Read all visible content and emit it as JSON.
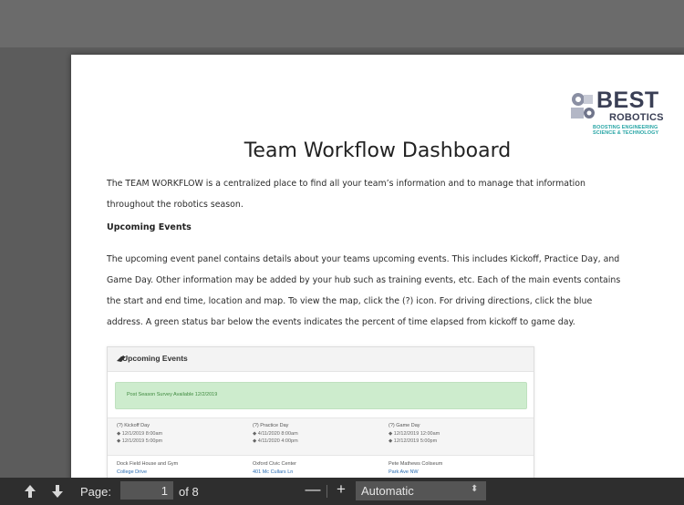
{
  "document": {
    "logo": {
      "name": "BEST",
      "sub": "ROBOTICS",
      "tagline_1": "BOOSTING ENGINEERING",
      "tagline_2": "SCIENCE & TECHNOLOGY"
    },
    "title": "Team Workflow Dashboard",
    "intro_line_1": "The TEAM WORKFLOW is a centralized place to find all your team’s information and to manage that information",
    "intro_line_2": "throughout the robotics season.",
    "section_heading": "Upcoming Events",
    "details_lines": [
      "The upcoming event panel contains details about your teams upcoming events. This includes Kickoff, Practice Day, and",
      "Game Day. Other information may be added by your hub such as training events, etc. Each of the main events contains",
      "the start and end time, location and map. To view the map, click the (?) icon. For driving directions, click the blue",
      "address. A green status bar below the events indicates the percent of time elapsed from kickoff to game day."
    ],
    "panel": {
      "title": "Upcoming Events",
      "alert": "Post Season Survey Available 12/2/2019",
      "events": [
        {
          "name": "(?)  Kickoff Day",
          "start": "◆  12/1/2019 8:00am",
          "end": "◆  12/1/2019 5:00pm"
        },
        {
          "name": "(?)  Practice Day",
          "start": "◆  4/11/2020 8:00am",
          "end": "◆  4/11/2020 4:00pm"
        },
        {
          "name": "(?)  Game Day",
          "start": "◆  12/12/2019 12:00am",
          "end": "◆  12/12/2019 5:00pm"
        }
      ],
      "locations": [
        {
          "name": "Dock Field House and Gym",
          "address": "College Drive"
        },
        {
          "name": "Oxford Civic Center",
          "address": "401 Mc Cullars Ln"
        },
        {
          "name": "Pete Mathews Coliseum",
          "address": "Park Ave NW"
        }
      ]
    }
  },
  "toolbar": {
    "page_label": "Page:",
    "page_value": "1",
    "page_of": "of 8",
    "zoom_out": "—",
    "zoom_in": "+",
    "zoom_value": "Automatic",
    "zoom_caret": "⬍"
  },
  "colors": {
    "viewer_bg": "#5c5c5c",
    "toolbar_bg": "#2e2e2e",
    "alert_bg": "#cdeccd",
    "logo_text": "#3a3f55",
    "logo_teal": "#27a5a5",
    "link_blue": "#2a6db3"
  }
}
